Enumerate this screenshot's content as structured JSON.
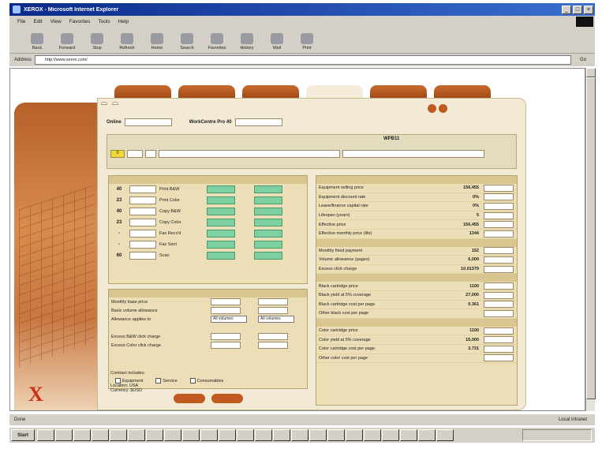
{
  "window": {
    "title": "XEROX - Microsoft Internet Explorer",
    "buttons": [
      "_",
      "□",
      "×"
    ]
  },
  "menu": [
    "File",
    "Edit",
    "View",
    "Favorites",
    "Tools",
    "Help"
  ],
  "toolbar": [
    "Back",
    "Forward",
    "Stop",
    "Refresh",
    "Home",
    "Search",
    "Favorites",
    "History",
    "Mail",
    "Print"
  ],
  "address": {
    "label": "Address",
    "url": "http://www.xerox.com/",
    "go": "Go"
  },
  "status": {
    "left": "Done",
    "zone": "Local intranet"
  },
  "taskbar": {
    "start": "Start",
    "clock": ""
  },
  "page": {
    "tabs": [
      "",
      "",
      "",
      "",
      "",
      ""
    ],
    "header": {
      "customer_value": "Online",
      "model_value": "WorkCentre Pro 40"
    },
    "config": {
      "code": "0",
      "label_right": "WPB11"
    },
    "volume_rows": [
      {
        "num": "40",
        "label": "Print B&W"
      },
      {
        "num": "23",
        "label": "Print Color"
      },
      {
        "num": "40",
        "label": "Copy B&W"
      },
      {
        "num": "23",
        "label": "Copy Color"
      },
      {
        "num": "-",
        "label": "Fax Recv'd"
      },
      {
        "num": "-",
        "label": "Fax Sent"
      },
      {
        "num": "60",
        "label": "Scan"
      }
    ],
    "cost_rows": [
      {
        "label": "Monthly base price"
      },
      {
        "label": "Basic volume allowance"
      },
      {
        "label": "Allowance applies to",
        "sel1": "All volumes",
        "sel2": "All volumes"
      },
      {
        "label": ""
      },
      {
        "label": "Excess B&W click charge"
      },
      {
        "label": "Excess Color click charge"
      }
    ],
    "contract": {
      "label": "Contract includes:",
      "opts": [
        "Equipment",
        "Service",
        "Consumables"
      ],
      "loc": "Location: USA",
      "cur": "Currency: $USD"
    },
    "right_rows": [
      {
        "label": "Equipment selling price",
        "val": "156,455"
      },
      {
        "label": "Equipment discount rate",
        "val": "0%"
      },
      {
        "label": "Lease/finance capital rate",
        "val": "0%"
      },
      {
        "label": "Lifespan (years)",
        "val": "5"
      },
      {
        "label": "Effective price",
        "val": "156,455"
      },
      {
        "label": "Effective monthly price (life)",
        "val": "1344"
      },
      {
        "label": "",
        "val": "",
        "head": true
      },
      {
        "label": "Monthly fixed payment",
        "val": "152"
      },
      {
        "label": "Volume allowance (pages)",
        "val": "6,000"
      },
      {
        "label": "Excess click charge",
        "val": "10.01379"
      },
      {
        "label": "",
        "val": "",
        "head": true
      },
      {
        "label": "Black cartridge price",
        "val": "1100"
      },
      {
        "label": "Black yield at 5% coverage",
        "val": "27,000"
      },
      {
        "label": "Black cartridge cost per page",
        "val": "0.361"
      },
      {
        "label": "Other black cost per page",
        "val": ""
      },
      {
        "label": "",
        "val": "",
        "head": true
      },
      {
        "label": "Color cartridge price",
        "val": "1100"
      },
      {
        "label": "Color yield at 5% coverage",
        "val": "15,000"
      },
      {
        "label": "Color cartridge cost per page",
        "val": "3.731"
      },
      {
        "label": "Other color cost per page",
        "val": ""
      }
    ],
    "buttons": [
      "",
      ""
    ]
  }
}
